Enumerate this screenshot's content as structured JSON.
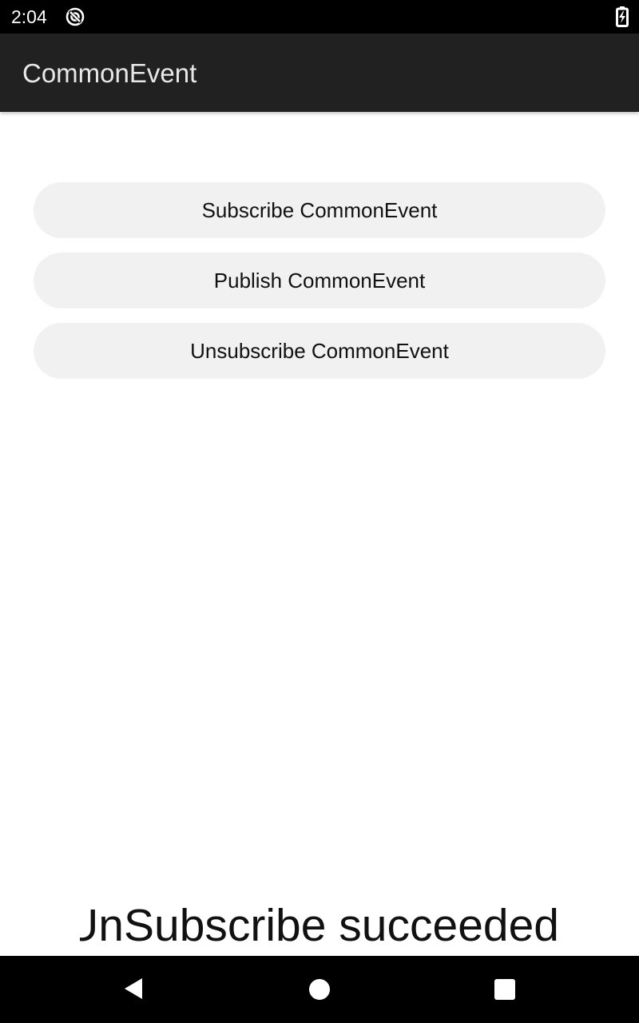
{
  "status_bar": {
    "time": "2:04",
    "icons": [
      "sync-icon",
      "battery-charging-icon"
    ]
  },
  "app_bar": {
    "title": "CommonEvent"
  },
  "buttons": {
    "subscribe": "Subscribe CommonEvent",
    "publish": "Publish CommonEvent",
    "unsubscribe": "Unsubscribe CommonEvent"
  },
  "result": {
    "message": "UnSubscribe succeeded"
  },
  "nav_bar": {
    "icons": [
      "back-icon",
      "home-icon",
      "recents-icon"
    ]
  },
  "colors": {
    "status_bar_bg": "#000000",
    "app_bar_bg": "#212121",
    "button_bg": "#f1f1f1",
    "nav_bar_bg": "#000000"
  }
}
